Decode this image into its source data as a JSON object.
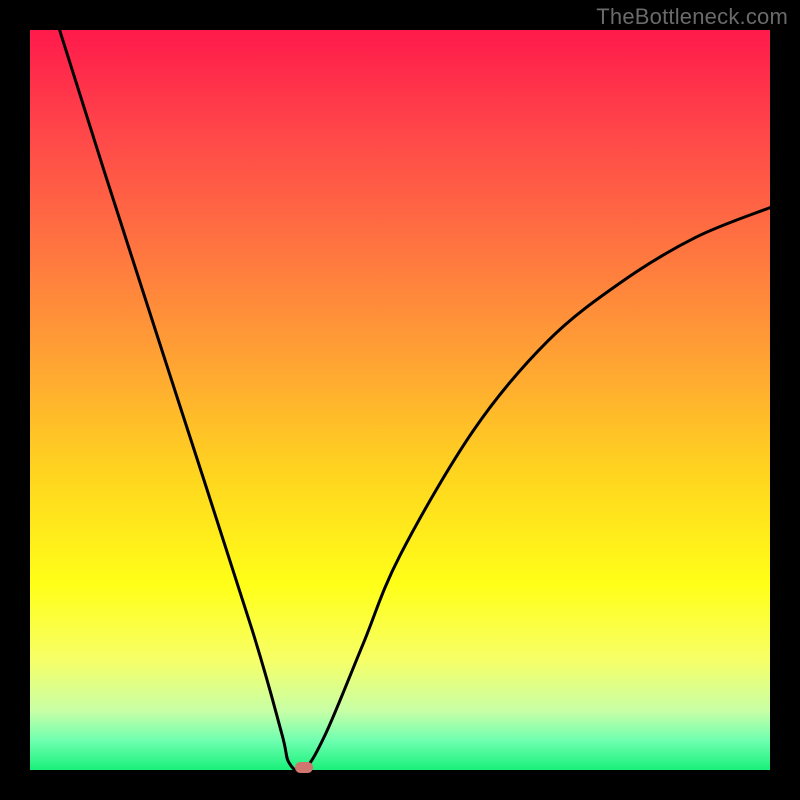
{
  "watermark": {
    "text": "TheBottleneck.com"
  },
  "colors": {
    "background": "#000000",
    "curve": "#000000",
    "marker": "#cf766f",
    "watermark_text": "#6a6a6a",
    "gradient_top": "#ff1a4b",
    "gradient_mid": "#ffff18",
    "gradient_bottom": "#19f07a"
  },
  "chart_data": {
    "type": "line",
    "title": "",
    "xlabel": "",
    "ylabel": "",
    "xlim": [
      0,
      100
    ],
    "ylim": [
      0,
      100
    ],
    "grid": false,
    "legend_position": "none",
    "series": [
      {
        "name": "bottleneck-curve",
        "x": [
          4,
          10,
          20,
          30,
          34,
          35,
          37,
          40,
          45,
          50,
          60,
          70,
          80,
          90,
          100
        ],
        "values": [
          100,
          81,
          50,
          19,
          5,
          1,
          0,
          5,
          17,
          29,
          46,
          58,
          66,
          72,
          76
        ]
      }
    ],
    "annotations": [
      {
        "name": "minimum-marker",
        "x": 37,
        "y": 0
      }
    ]
  }
}
